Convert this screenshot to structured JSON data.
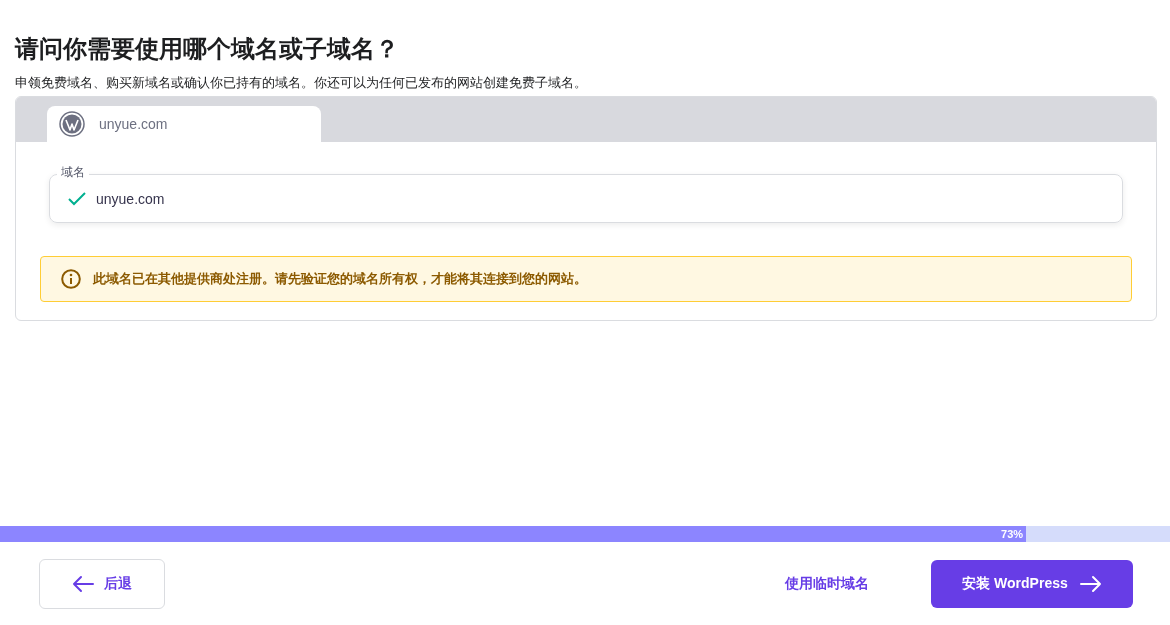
{
  "heading": "请问你需要使用哪个域名或子域名？",
  "subtitle": "申领免费域名、购买新域名或确认你已持有的域名。你还可以为任何已发布的网站创建免费子域名。",
  "tabs": [
    {
      "label": "unyue.com",
      "selected": true
    }
  ],
  "domain_field": {
    "label": "域名",
    "value": "unyue.com",
    "valid": true
  },
  "notice": {
    "text": "此域名已在其他提供商处注册。请先验证您的域名所有权，才能将其连接到您的网站。"
  },
  "progress": {
    "level": 0.877,
    "reading": "73%"
  },
  "footer": {
    "back": "后退",
    "temp_domain": "使用临时域名",
    "install": "安装 WordPress"
  }
}
